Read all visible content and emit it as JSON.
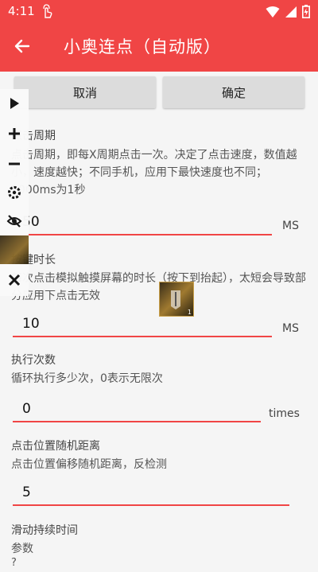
{
  "status_bar": {
    "time": "4:11"
  },
  "app_bar": {
    "title": "小奥连点（自动版）"
  },
  "actions": {
    "cancel": "取消",
    "confirm": "确定"
  },
  "sections": {
    "click_period": {
      "title": "点击周期",
      "desc": "点击周期，即每X周期点击一次。决定了点击速度，数值越小，速度越快；不同手机，应用下最快速度也不同；1000ms为1秒",
      "value": "50",
      "unit": "MS"
    },
    "press_duration": {
      "title": "按键时长",
      "desc": "每次点击模拟触摸屏幕的时长（按下到抬起），太短会导致部分应用下点击无效",
      "value": "10",
      "unit": "MS"
    },
    "repeat_count": {
      "title": "执行次数",
      "desc": "循环执行多少次，0表示无限次",
      "value": "0",
      "unit": "times"
    },
    "random_offset": {
      "title": "点击位置随机距离",
      "desc": "点击位置偏移随机距离，反检测",
      "value": "5"
    },
    "swipe_duration": {
      "title": "滑动持续时间",
      "desc": "参数",
      "value": "?"
    }
  },
  "floating_target": {
    "badge": "1"
  },
  "colors": {
    "accent": "#f04545",
    "button": "#dcdcdc"
  },
  "icons": [
    "play-icon",
    "plus-icon",
    "minus-icon",
    "gear-icon",
    "eye-off-icon",
    "close-icon",
    "back-arrow-icon",
    "wifi-icon",
    "signal-icon",
    "battery-icon"
  ]
}
